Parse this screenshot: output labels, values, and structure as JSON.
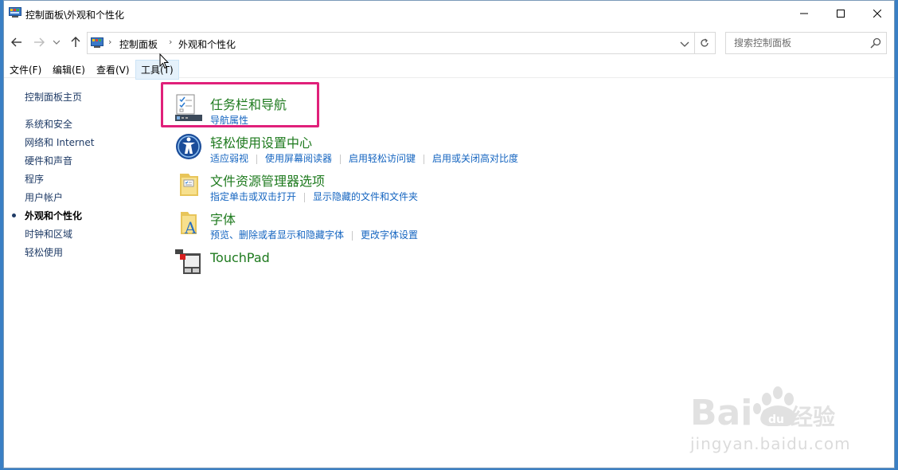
{
  "window": {
    "title": "控制面板\\外观和个性化"
  },
  "address": {
    "crumbs": [
      "控制面板",
      "外观和个性化"
    ]
  },
  "search": {
    "placeholder": "搜索控制面板"
  },
  "menu": {
    "items": [
      "文件(F)",
      "编辑(E)",
      "查看(V)",
      "工具(T)"
    ]
  },
  "sidebar": {
    "items": [
      "控制面板主页",
      "系统和安全",
      "网络和 Internet",
      "硬件和声音",
      "程序",
      "用户帐户",
      "外观和个性化",
      "时钟和区域",
      "轻松使用"
    ],
    "current_index": 6
  },
  "categories": [
    {
      "title": "任务栏和导航",
      "icon": "taskbar-icon",
      "links": [
        "导航属性"
      ]
    },
    {
      "title": "轻松使用设置中心",
      "icon": "ease-of-access-icon",
      "links": [
        "适应弱视",
        "使用屏幕阅读器",
        "启用轻松访问键",
        "启用或关闭高对比度"
      ]
    },
    {
      "title": "文件资源管理器选项",
      "icon": "folder-options-icon",
      "links": [
        "指定单击或双击打开",
        "显示隐藏的文件和文件夹"
      ]
    },
    {
      "title": "字体",
      "icon": "fonts-folder-icon",
      "links": [
        "预览、删除或者显示和隐藏字体",
        "更改字体设置"
      ]
    },
    {
      "title": "TouchPad",
      "icon": "touchpad-icon",
      "links": []
    }
  ],
  "watermark": {
    "text": "jingyan.baidu.com"
  },
  "colors": {
    "category_title": "#1e7a1e",
    "link": "#1565c0",
    "highlight_box": "#e0207a"
  }
}
